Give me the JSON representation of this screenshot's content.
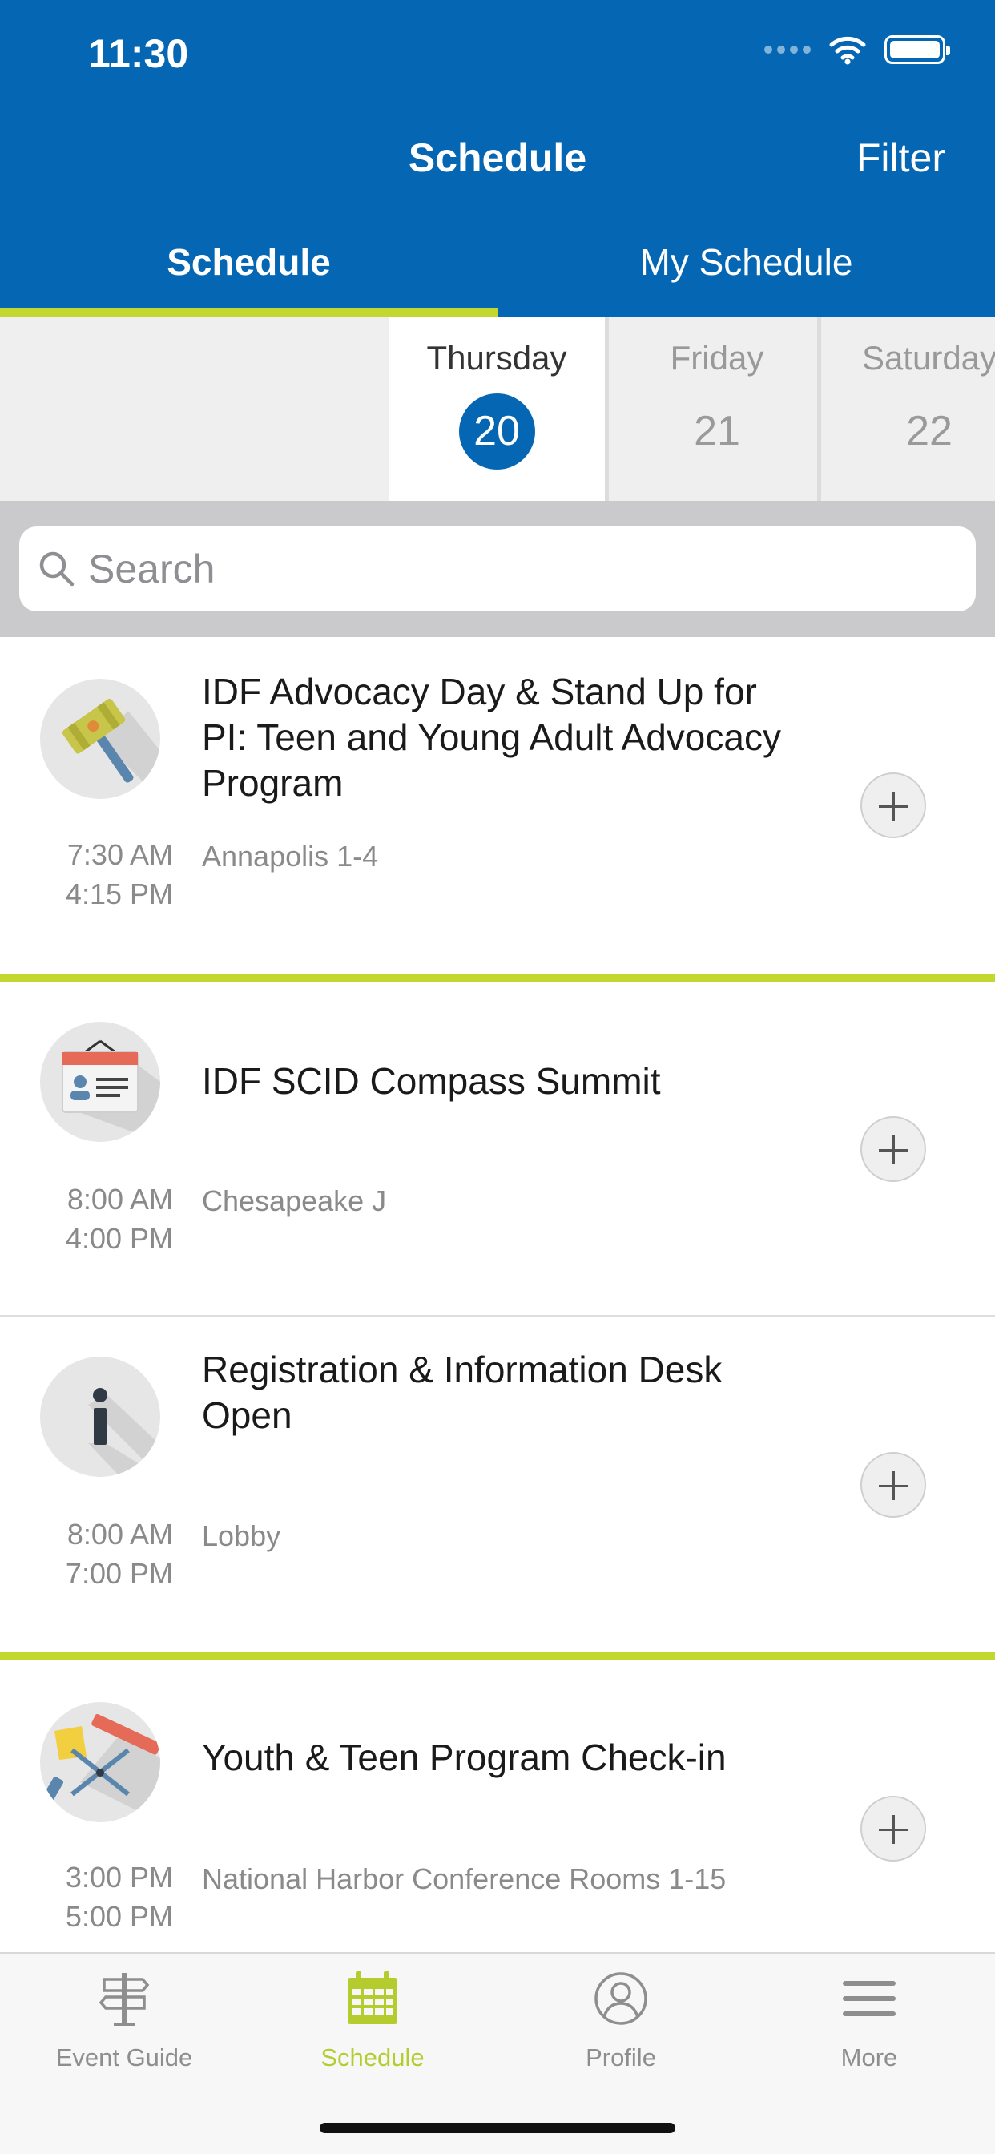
{
  "status_bar": {
    "time": "11:30"
  },
  "nav": {
    "title": "Schedule",
    "filter_label": "Filter"
  },
  "segment_tabs": [
    {
      "label": "Schedule",
      "active": true
    },
    {
      "label": "My Schedule",
      "active": false
    }
  ],
  "days": [
    {
      "name": "Thursday",
      "number": "20",
      "selected": true
    },
    {
      "name": "Friday",
      "number": "21",
      "selected": false
    },
    {
      "name": "Saturday",
      "number": "22",
      "selected": false
    }
  ],
  "search": {
    "placeholder": "Search",
    "value": ""
  },
  "sessions": [
    {
      "title": "IDF Advocacy Day & Stand Up for PI: Teen and Young Adult Advocacy Program",
      "start": "7:30 AM",
      "end": "4:15 PM",
      "location": "Annapolis 1-4",
      "icon": "gavel-icon"
    },
    {
      "title": "IDF SCID Compass Summit",
      "start": "8:00 AM",
      "end": "4:00 PM",
      "location": "Chesapeake J",
      "icon": "name-badge-icon"
    },
    {
      "title": "Registration & Information Desk Open",
      "start": "8:00 AM",
      "end": "7:00 PM",
      "location": "Lobby",
      "icon": "info-icon"
    },
    {
      "title": "Youth & Teen Program Check-in",
      "start": "3:00 PM",
      "end": "5:00 PM",
      "location": "National Harbor Conference Rooms 1-15",
      "icon": "craft-supplies-icon"
    }
  ],
  "tabbar": [
    {
      "label": "Event Guide",
      "icon": "signpost-icon",
      "active": false
    },
    {
      "label": "Schedule",
      "icon": "calendar-icon",
      "active": true
    },
    {
      "label": "Profile",
      "icon": "profile-icon",
      "active": false
    },
    {
      "label": "More",
      "icon": "menu-icon",
      "active": false
    }
  ],
  "colors": {
    "header_blue": "#0567b3",
    "accent_green": "#c3d82f",
    "tab_active": "#b5cc2f"
  }
}
